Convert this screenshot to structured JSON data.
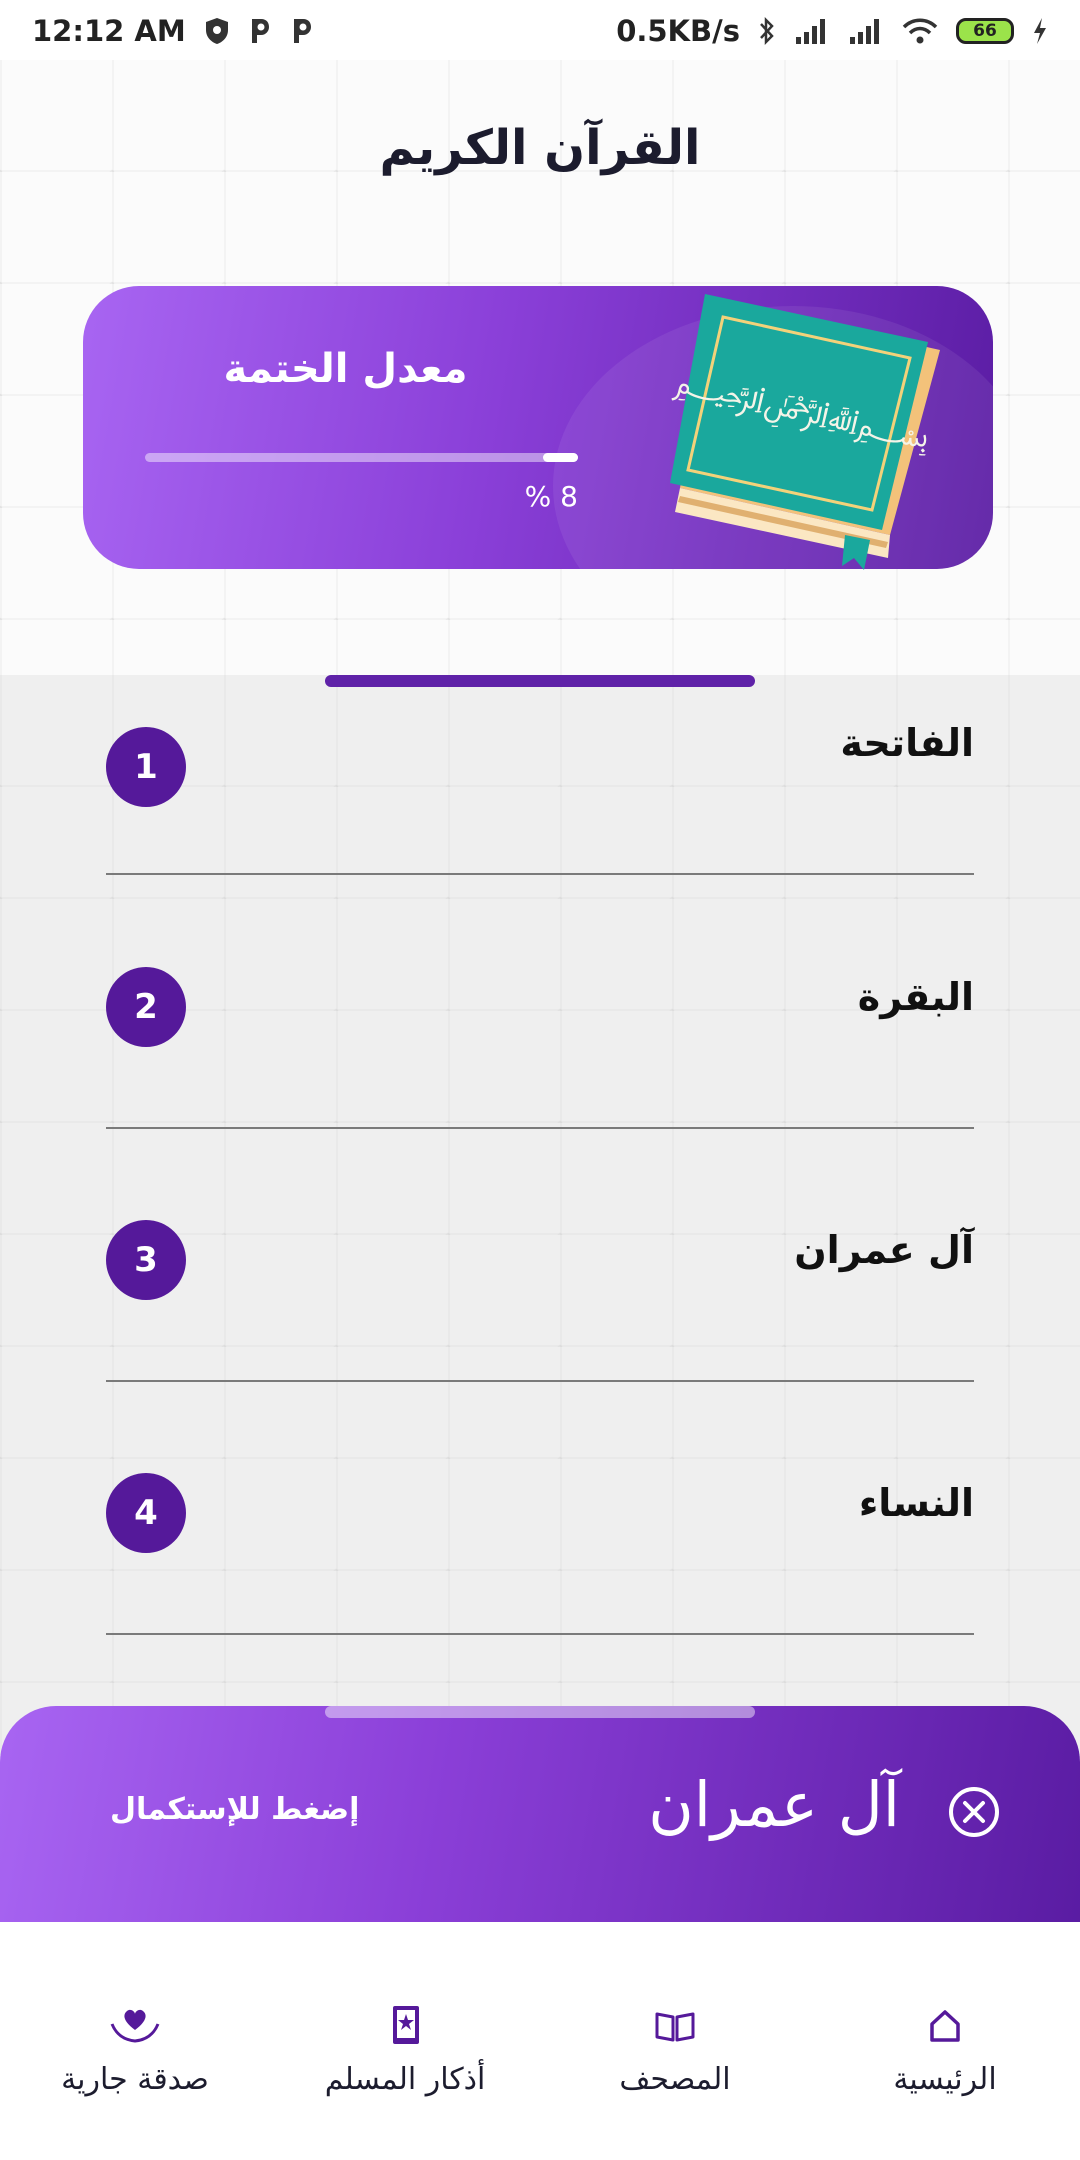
{
  "status_bar": {
    "time": "12:12 AM",
    "speed": "0.5KB/s",
    "battery": "66",
    "icons": [
      "shield-icon",
      "parking-icon",
      "parking-icon",
      "bluetooth-icon",
      "signal-icon",
      "signal-icon",
      "wifi-icon",
      "battery-icon",
      "charging-icon"
    ]
  },
  "header": {
    "title": "القرآن الكريم"
  },
  "progress_card": {
    "title": "معدل الختمة",
    "percent_label": "8 %",
    "progress_value": 0.08
  },
  "surahs": [
    {
      "name": "الفاتحة",
      "number": "1"
    },
    {
      "name": "البقرة",
      "number": "2"
    },
    {
      "name": "آل عمران",
      "number": "3"
    },
    {
      "name": "النساء",
      "number": "4"
    }
  ],
  "continue_panel": {
    "surah": "آل عمران",
    "action_label": "إضغط للإستكمال"
  },
  "bottom_nav": {
    "items": [
      {
        "label": "الرئيسية",
        "icon": "home-icon"
      },
      {
        "label": "المصحف",
        "icon": "open-book-icon"
      },
      {
        "label": "أذكار المسلم",
        "icon": "prayer-book-icon"
      },
      {
        "label": "صدقة جارية",
        "icon": "charity-heart-icon"
      }
    ]
  },
  "colors": {
    "accent": "#55199a",
    "gradient_start": "#a865f2",
    "gradient_end": "#5a1ca3",
    "book_teal": "#1aa89d"
  }
}
